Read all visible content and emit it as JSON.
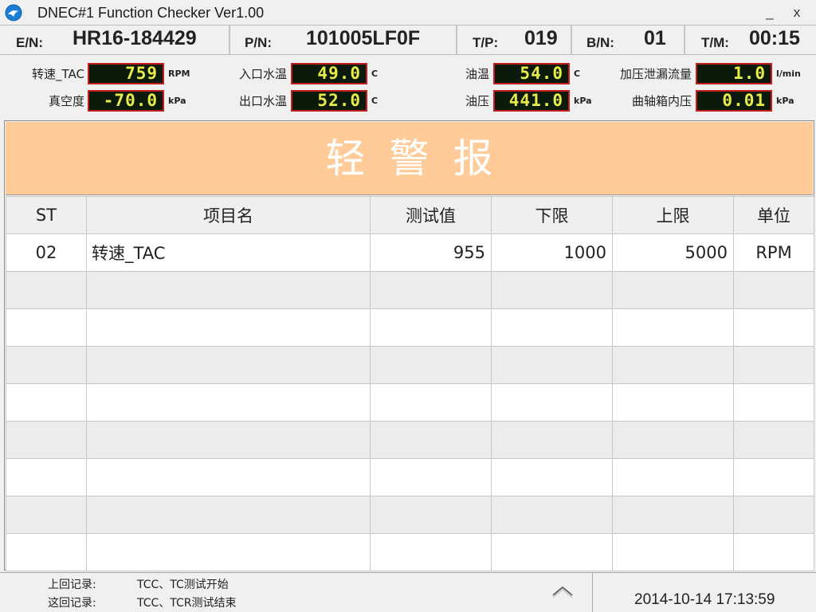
{
  "window": {
    "title": "DNEC#1 Function Checker Ver1.00",
    "min_glyph": "_",
    "close_glyph": "x"
  },
  "info": [
    {
      "label": "E/N:",
      "value": "HR16-184429"
    },
    {
      "label": "P/N:",
      "value": "101005LF0F"
    },
    {
      "label": "T/P:",
      "value": "019"
    },
    {
      "label": "B/N:",
      "value": "01"
    },
    {
      "label": "T/M:",
      "value": "00:15"
    }
  ],
  "gauges": [
    {
      "label": "转速_TAC",
      "value": "759",
      "unit": "RPM"
    },
    {
      "label": "入口水温",
      "value": "49.0",
      "unit": "C"
    },
    {
      "label": "油温",
      "value": "54.0",
      "unit": "C"
    },
    {
      "label": "加压泄漏流量",
      "value": "1.0",
      "unit": "l/min"
    },
    {
      "label": "真空度",
      "value": "-70.0",
      "unit": "kPa"
    },
    {
      "label": "出口水温",
      "value": "52.0",
      "unit": "C"
    },
    {
      "label": "油压",
      "value": "441.0",
      "unit": "kPa"
    },
    {
      "label": "曲轴箱内压",
      "value": "0.01",
      "unit": "kPa"
    }
  ],
  "alarm": {
    "text": "轻警报",
    "color": "#ffcc99"
  },
  "table": {
    "headers": [
      "ST",
      "项目名",
      "测试值",
      "下限",
      "上限",
      "单位"
    ],
    "rows": [
      [
        "02",
        "转速_TAC",
        "955",
        "1000",
        "5000",
        "RPM"
      ],
      [
        "",
        "",
        "",
        "",
        "",
        ""
      ],
      [
        "",
        "",
        "",
        "",
        "",
        ""
      ],
      [
        "",
        "",
        "",
        "",
        "",
        ""
      ],
      [
        "",
        "",
        "",
        "",
        "",
        ""
      ],
      [
        "",
        "",
        "",
        "",
        "",
        ""
      ],
      [
        "",
        "",
        "",
        "",
        "",
        ""
      ],
      [
        "",
        "",
        "",
        "",
        "",
        ""
      ],
      [
        "",
        "",
        "",
        "",
        "",
        ""
      ]
    ]
  },
  "status": {
    "prev_label": "上回记录:",
    "prev_text": "TCC、TC测试开始",
    "curr_label": "这回记录:",
    "curr_text": "TCC、TCR测试结束",
    "datetime": "2014-10-14 17:13:59"
  },
  "colors": {
    "gauge_bg": "#0b1a0b",
    "gauge_border": "#c21e1e",
    "gauge_digits": "#e8ec4a",
    "alarm_banner": "#ffcc99"
  },
  "icons": {
    "app": "app-globe-icon",
    "scroll_up": "chevron-up-icon"
  }
}
